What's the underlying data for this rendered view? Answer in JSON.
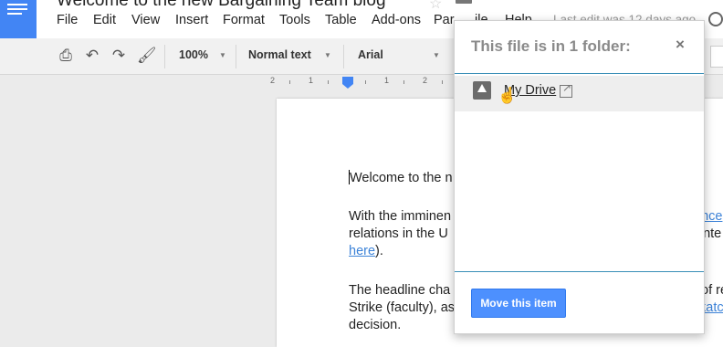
{
  "app": {
    "doc_title": "Welcome to the new Bargaining Team blog",
    "last_edit": "Last edit was 12 days ago"
  },
  "menubar": {
    "items": [
      "File",
      "Edit",
      "View",
      "Insert",
      "Format",
      "Tools",
      "Table",
      "Add-ons",
      "Par",
      "ile",
      "Help"
    ]
  },
  "toolbar": {
    "zoom": "100%",
    "style": "Normal text",
    "font": "Arial",
    "icons": [
      "print-icon",
      "undo-icon",
      "redo-icon",
      "paint-format-icon"
    ]
  },
  "ruler": {
    "numbers": [
      "2",
      "1",
      "1",
      "2",
      "3"
    ]
  },
  "document": {
    "line1": "Welcome to the n",
    "p2_line1": "With the imminen",
    "p2_link1": "ance",
    "p2_line2": "relations in the U",
    "p2_line2_end": "ente",
    "p2_link2": "here",
    "p2_link2_after": ").",
    "p3_line1": "The headline cha",
    "p3_line1_end": "of re",
    "p3_line2": "Strike (faculty), as",
    "p3_link": "katc",
    "p3_line3": "decision."
  },
  "popup": {
    "title": "This file is in 1 folder:",
    "close_symbol": "×",
    "folder_name": "My Drive",
    "move_button": "Move this item"
  },
  "colors": {
    "brand_blue": "#4285f4",
    "button_blue": "#4d90fe",
    "link_blue": "#3d83d8",
    "divider_teal": "#3a8fb7"
  }
}
